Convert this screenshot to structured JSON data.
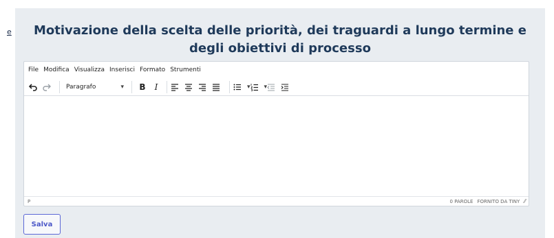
{
  "left_fragment": "e",
  "section": {
    "title": "Motivazione della scelta delle priorità, dei traguardi a lungo termine e degli obiettivi di processo"
  },
  "editor": {
    "menu": [
      "File",
      "Modifica",
      "Visualizza",
      "Inserisci",
      "Formato",
      "Strumenti"
    ],
    "format_select": "Paragrafo",
    "status_path": "P",
    "word_count": "0 PAROLE",
    "powered_by": "FORNITO DA TINY"
  },
  "actions": {
    "save_label": "Salva"
  }
}
